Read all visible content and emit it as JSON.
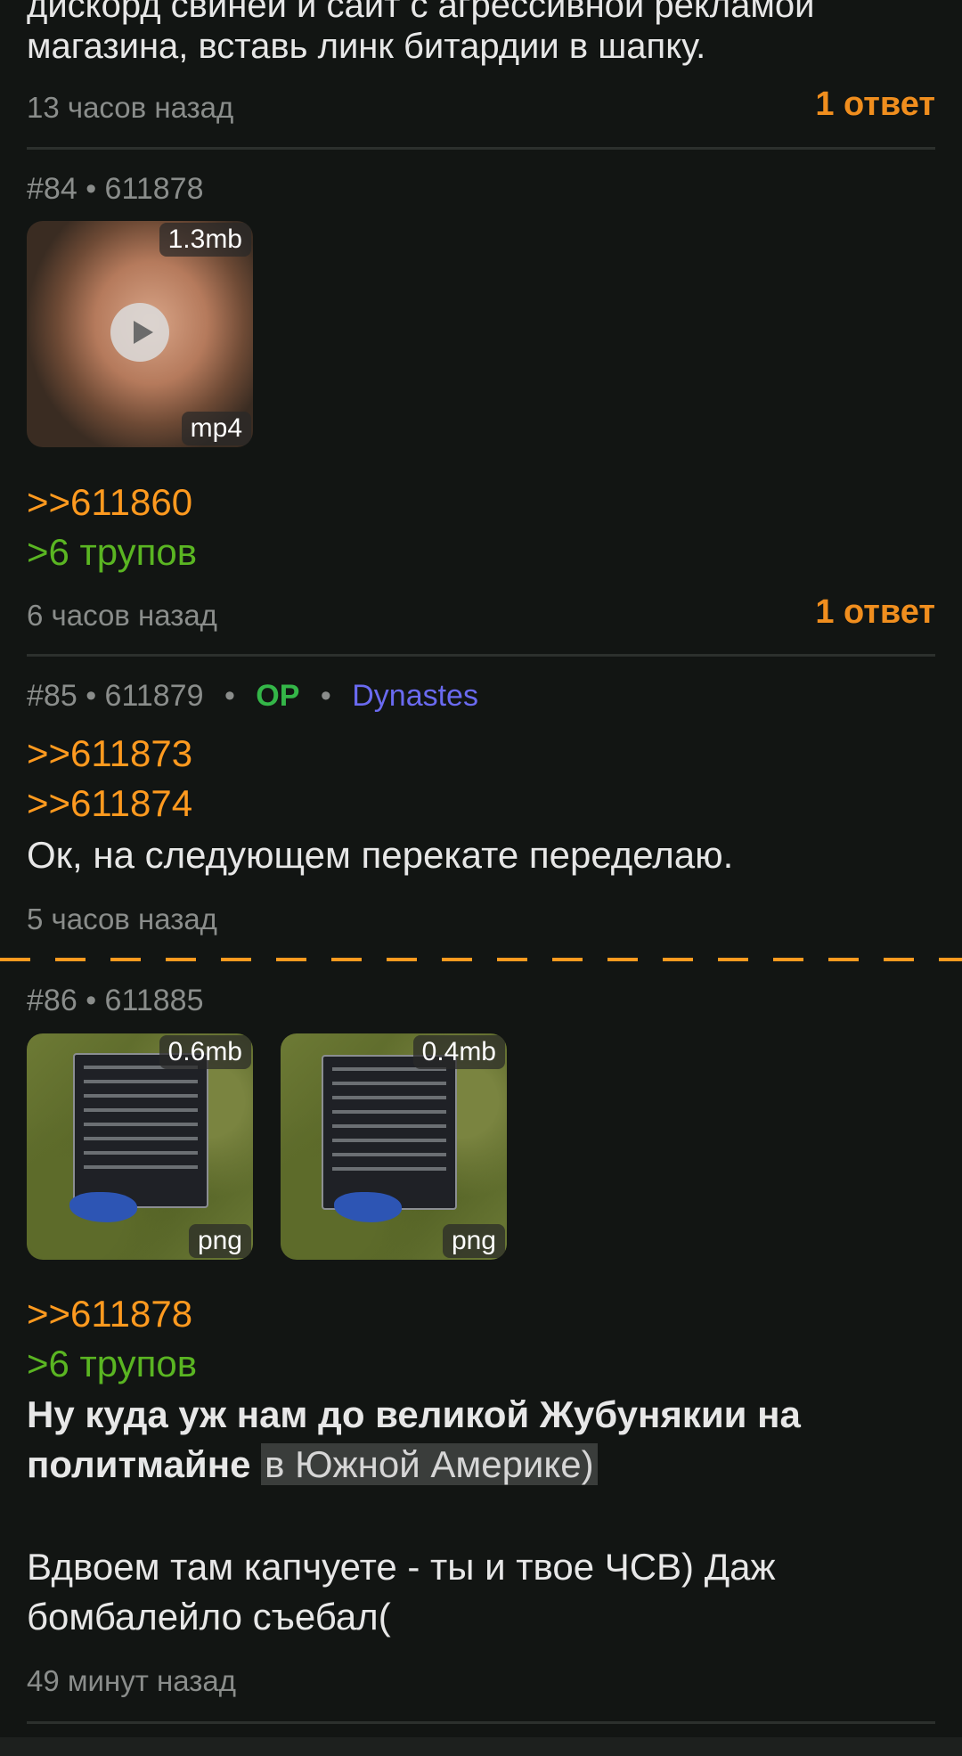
{
  "prev_post": {
    "text_line1": "дискорд свиней и сайт с агрессивной рекламой",
    "text_line2": "магазина, вставь линк битардии в шапку.",
    "time": "13 часов назад",
    "replies": "1 ответ"
  },
  "post84": {
    "number": "#84",
    "sep": "•",
    "id": "611878",
    "media": {
      "size": "1.3mb",
      "type": "mp4",
      "icon": "play-icon"
    },
    "reply_link": ">>611860",
    "greentext": ">6 трупов",
    "time": "6 часов назад",
    "replies": "1 ответ"
  },
  "post85": {
    "number": "#85",
    "sep": "•",
    "id": "611879",
    "op": "OP",
    "trip": "Dynastes",
    "reply_links": [
      ">>611873",
      ">>611874"
    ],
    "text": "Ок, на следующем перекате переделаю.",
    "time": "5 часов назад"
  },
  "post86": {
    "number": "#86",
    "sep": "•",
    "id": "611885",
    "media": [
      {
        "size": "0.6mb",
        "type": "png"
      },
      {
        "size": "0.4mb",
        "type": "png"
      }
    ],
    "reply_link": ">>611878",
    "greentext": ">6 трупов",
    "bold_line1": "Ну куда уж нам до великой Жубунякии на",
    "bold_line2": "политмайне",
    "spoiler": "в Южной Америке)",
    "text_line1": "Вдвоем там капчуете - ты и твое ЧСВ) Даж",
    "text_line2": "бомбалейло съебал(",
    "time": "49 минут назад"
  },
  "colors": {
    "background": "#121513",
    "accent_orange": "#ff9a1f",
    "greentext": "#5ab522",
    "op": "#34b648",
    "trip": "#6a6af0",
    "meta_gray": "#8a8d8b"
  }
}
